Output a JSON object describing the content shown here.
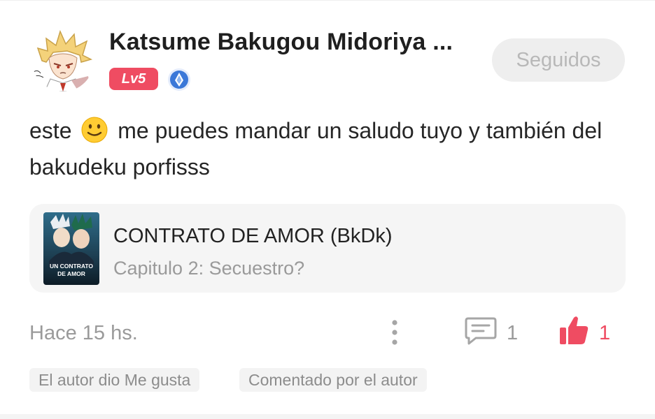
{
  "post": {
    "author_name": "Katsume Bakugou Midoriya ...",
    "level_badge": "Lv5",
    "follow_label": "Seguidos",
    "comment_part1": "este",
    "comment_part2": "me puedes mandar un saludo tuyo y también del bakudeku porfisss",
    "emoji": "slightly-smiling-face"
  },
  "book": {
    "title": "CONTRATO DE AMOR (BkDk)",
    "chapter": "Capitulo 2: Secuestro?",
    "cover_text_line1": "UN CONTRATO",
    "cover_text_line2": "DE AMOR"
  },
  "footer": {
    "timestamp": "Hace 15 hs.",
    "comment_count": "1",
    "like_count": "1",
    "tags": [
      "El autor dio Me gusta",
      "Comentado por el autor"
    ]
  },
  "colors": {
    "accent": "#ef4c62",
    "muted_text": "#9a9a9a",
    "card_bg": "#f5f5f5"
  },
  "icons": [
    "medal-icon",
    "more-vertical-icon",
    "comment-icon",
    "thumbs-up-icon"
  ]
}
